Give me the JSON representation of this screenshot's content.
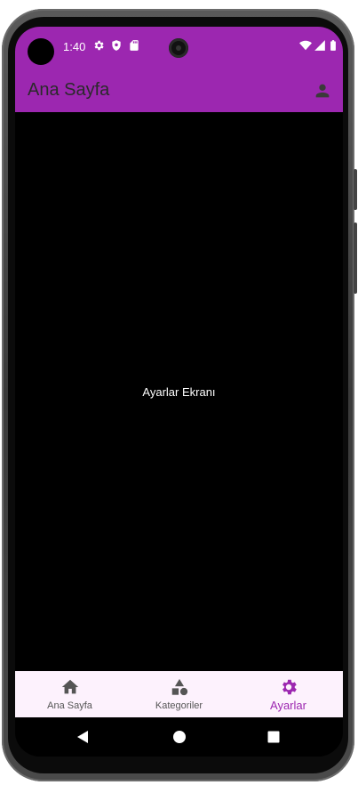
{
  "status_bar": {
    "time": "1:40"
  },
  "app_bar": {
    "title": "Ana Sayfa"
  },
  "body": {
    "text": "Ayarlar Ekranı"
  },
  "bottom_nav": {
    "items": [
      {
        "label": "Ana Sayfa",
        "icon": "home-icon",
        "active": false
      },
      {
        "label": "Kategoriler",
        "icon": "categories-icon",
        "active": false
      },
      {
        "label": "Ayarlar",
        "icon": "settings-icon",
        "active": true
      }
    ]
  },
  "colors": {
    "primary": "#9c27b0",
    "nav_background": "#fdf2fd",
    "body_background": "#000000"
  }
}
